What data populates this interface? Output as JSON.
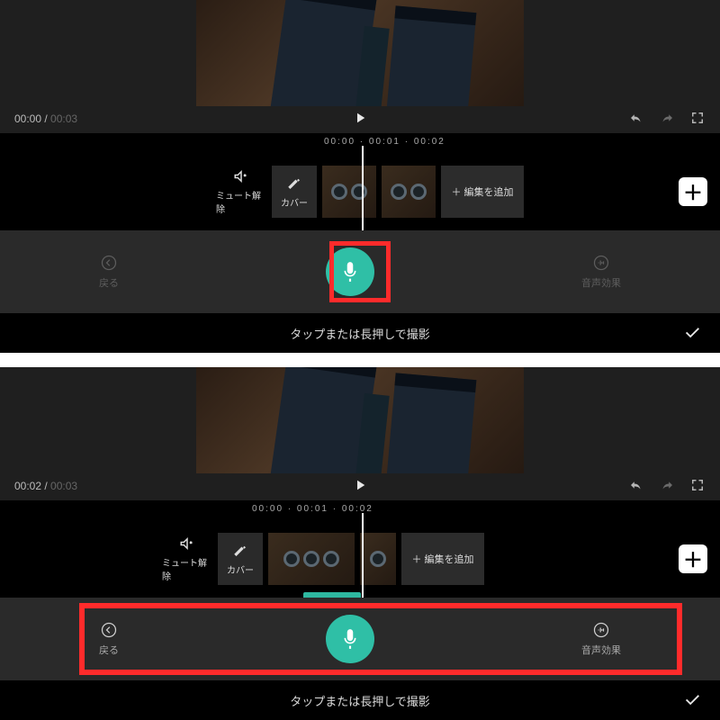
{
  "colors": {
    "accent": "#2fbfa6",
    "highlight": "#ff2b2b"
  },
  "top": {
    "current_time": "00:00",
    "duration": "00:03",
    "ticks": "00:00    ·    00:01    ·    00:02",
    "mute_label": "ミュート解除",
    "cover_label": "カバー",
    "add_clip_label": "＋ 編集を追加",
    "back_label": "戻る",
    "voice_effect_label": "音声効果",
    "footer_hint": "タップまたは長押しで撮影"
  },
  "bottom": {
    "current_time": "00:02",
    "duration": "00:03",
    "ticks": "00:00    ·    00:01    ·    00:02",
    "mute_label": "ミュート解除",
    "cover_label": "カバー",
    "add_clip_label": "＋ 編集を追加",
    "back_label": "戻る",
    "voice_effect_label": "音声効果",
    "footer_hint": "タップまたは長押しで撮影"
  }
}
